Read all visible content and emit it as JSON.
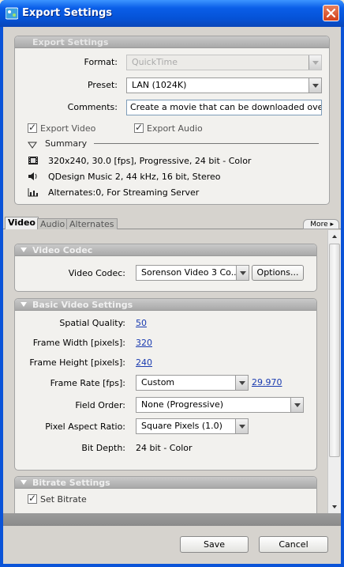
{
  "window": {
    "title": "Export Settings"
  },
  "export_settings": {
    "header": "Export Settings",
    "format_label": "Format:",
    "format_value": "QuickTime",
    "preset_label": "Preset:",
    "preset_value": "LAN (1024K)",
    "comments_label": "Comments:",
    "comments_value": "Create a movie that can be downloaded over a Lo",
    "export_video_label": "Export Video",
    "export_audio_label": "Export Audio",
    "summary_label": "Summary",
    "summary_lines": [
      {
        "icon": "film-icon",
        "text": "320x240, 30.0 [fps], Progressive, 24 bit - Color"
      },
      {
        "icon": "speaker-icon",
        "text": "QDesign Music 2, 44 kHz, 16 bit, Stereo"
      },
      {
        "icon": "bar-chart-icon",
        "text": "Alternates:0, For Streaming Server"
      }
    ]
  },
  "tabs": [
    {
      "label": "Video",
      "active": true
    },
    {
      "label": "Audio",
      "active": false
    },
    {
      "label": "Alternates",
      "active": false
    }
  ],
  "more_label": "More ▸",
  "video_codec": {
    "header": "Video Codec",
    "codec_label": "Video Codec:",
    "codec_value": "Sorenson Video 3 Co...",
    "options_label": "Options..."
  },
  "basic_video": {
    "header": "Basic Video Settings",
    "spatial_quality_label": "Spatial Quality:",
    "spatial_quality_value": "50",
    "frame_width_label": "Frame Width [pixels]:",
    "frame_width_value": "320",
    "frame_height_label": "Frame Height [pixels]:",
    "frame_height_value": "240",
    "frame_rate_label": "Frame Rate [fps]:",
    "frame_rate_select": "Custom",
    "frame_rate_value": "29.970",
    "field_order_label": "Field Order:",
    "field_order_value": "None (Progressive)",
    "pixel_aspect_label": "Pixel Aspect Ratio:",
    "pixel_aspect_value": "Square Pixels (1.0)",
    "bit_depth_label": "Bit Depth:",
    "bit_depth_value": "24 bit - Color"
  },
  "bitrate": {
    "header": "Bitrate Settings",
    "set_bitrate_label": "Set Bitrate"
  },
  "footer": {
    "save_label": "Save",
    "cancel_label": "Cancel"
  },
  "colors": {
    "title_bar": "#0a5ee8",
    "link": "#1a3bb0",
    "panel": "#f2f1ee"
  }
}
